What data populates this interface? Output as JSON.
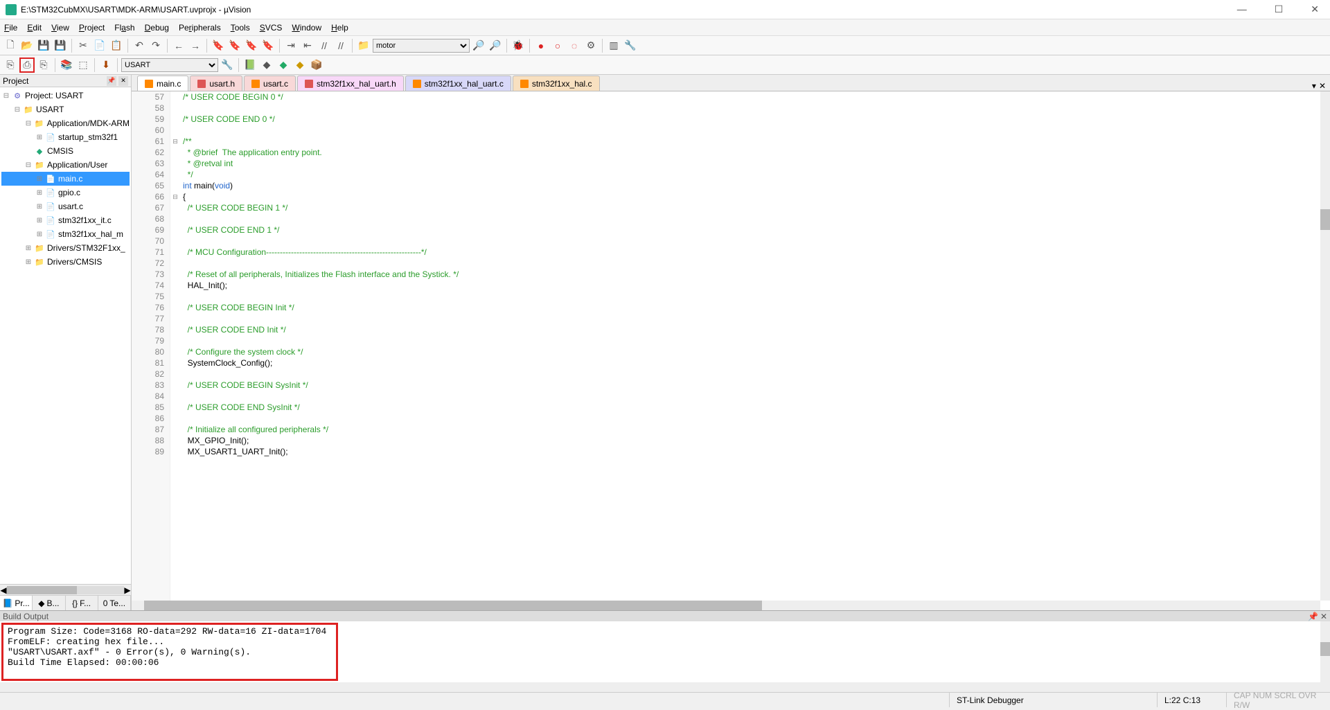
{
  "title": "E:\\STM32CubMX\\USART\\MDK-ARM\\USART.uvprojx - µVision",
  "menu": [
    "File",
    "Edit",
    "View",
    "Project",
    "Flash",
    "Debug",
    "Peripherals",
    "Tools",
    "SVCS",
    "Window",
    "Help"
  ],
  "toolbar1": {
    "search": "motor"
  },
  "toolbar2": {
    "target": "USART"
  },
  "project_panel": {
    "title": "Project",
    "root": "Project: USART",
    "group": "USART",
    "folders": [
      {
        "name": "Application/MDK-ARM",
        "files": [
          "startup_stm32f1"
        ]
      },
      {
        "name": "CMSIS",
        "icon": "cmsis",
        "files": []
      },
      {
        "name": "Application/User",
        "files": [
          "main.c",
          "gpio.c",
          "usart.c",
          "stm32f1xx_it.c",
          "stm32f1xx_hal_m"
        ]
      },
      {
        "name": "Drivers/STM32F1xx_",
        "files": []
      },
      {
        "name": "Drivers/CMSIS",
        "files": []
      }
    ],
    "selected": "main.c",
    "bottom_tabs": [
      "Pr...",
      "B...",
      "F...",
      "Te..."
    ]
  },
  "editor": {
    "tabs": [
      {
        "label": "main.c",
        "active": true,
        "type": "c"
      },
      {
        "label": "usart.h",
        "active": false,
        "type": "h"
      },
      {
        "label": "usart.c",
        "active": false,
        "type": "c"
      },
      {
        "label": "stm32f1xx_hal_uart.h",
        "active": false,
        "type": "h"
      },
      {
        "label": "stm32f1xx_hal_uart.c",
        "active": false,
        "type": "c"
      },
      {
        "label": "stm32f1xx_hal.c",
        "active": false,
        "type": "c"
      }
    ],
    "first_line": 57,
    "lines": [
      {
        "n": 57,
        "t": "/* USER CODE BEGIN 0 */",
        "c": "cm"
      },
      {
        "n": 58,
        "t": "",
        "c": ""
      },
      {
        "n": 59,
        "t": "/* USER CODE END 0 */",
        "c": "cm"
      },
      {
        "n": 60,
        "t": "",
        "c": ""
      },
      {
        "n": 61,
        "t": "/**",
        "c": "cm",
        "f": "⊟"
      },
      {
        "n": 62,
        "t": "  * @brief  The application entry point.",
        "c": "cm"
      },
      {
        "n": 63,
        "t": "  * @retval int",
        "c": "cm"
      },
      {
        "n": 64,
        "t": "  */",
        "c": "cm"
      },
      {
        "n": 65,
        "t": "int main(void)",
        "c": "kw"
      },
      {
        "n": 66,
        "t": "{",
        "c": "",
        "f": "⊟"
      },
      {
        "n": 67,
        "t": "  /* USER CODE BEGIN 1 */",
        "c": "cm"
      },
      {
        "n": 68,
        "t": "",
        "c": ""
      },
      {
        "n": 69,
        "t": "  /* USER CODE END 1 */",
        "c": "cm"
      },
      {
        "n": 70,
        "t": "",
        "c": ""
      },
      {
        "n": 71,
        "t": "  /* MCU Configuration--------------------------------------------------------*/",
        "c": "cm"
      },
      {
        "n": 72,
        "t": "",
        "c": ""
      },
      {
        "n": 73,
        "t": "  /* Reset of all peripherals, Initializes the Flash interface and the Systick. */",
        "c": "cm"
      },
      {
        "n": 74,
        "t": "  HAL_Init();",
        "c": ""
      },
      {
        "n": 75,
        "t": "",
        "c": ""
      },
      {
        "n": 76,
        "t": "  /* USER CODE BEGIN Init */",
        "c": "cm"
      },
      {
        "n": 77,
        "t": "",
        "c": ""
      },
      {
        "n": 78,
        "t": "  /* USER CODE END Init */",
        "c": "cm"
      },
      {
        "n": 79,
        "t": "",
        "c": ""
      },
      {
        "n": 80,
        "t": "  /* Configure the system clock */",
        "c": "cm"
      },
      {
        "n": 81,
        "t": "  SystemClock_Config();",
        "c": ""
      },
      {
        "n": 82,
        "t": "",
        "c": ""
      },
      {
        "n": 83,
        "t": "  /* USER CODE BEGIN SysInit */",
        "c": "cm"
      },
      {
        "n": 84,
        "t": "",
        "c": ""
      },
      {
        "n": 85,
        "t": "  /* USER CODE END SysInit */",
        "c": "cm"
      },
      {
        "n": 86,
        "t": "",
        "c": ""
      },
      {
        "n": 87,
        "t": "  /* Initialize all configured peripherals */",
        "c": "cm"
      },
      {
        "n": 88,
        "t": "  MX_GPIO_Init();",
        "c": ""
      },
      {
        "n": 89,
        "t": "  MX_USART1_UART_Init();",
        "c": ""
      }
    ]
  },
  "build": {
    "title": "Build Output",
    "lines": [
      "Program Size: Code=3168 RO-data=292 RW-data=16 ZI-data=1704",
      "FromELF: creating hex file...",
      "\"USART\\USART.axf\" - 0 Error(s), 0 Warning(s).",
      "Build Time Elapsed:  00:00:06"
    ]
  },
  "status": {
    "debugger": "ST-Link Debugger",
    "pos": "L:22 C:13",
    "caps": "CAP NUM SCRL OVR R/W"
  }
}
